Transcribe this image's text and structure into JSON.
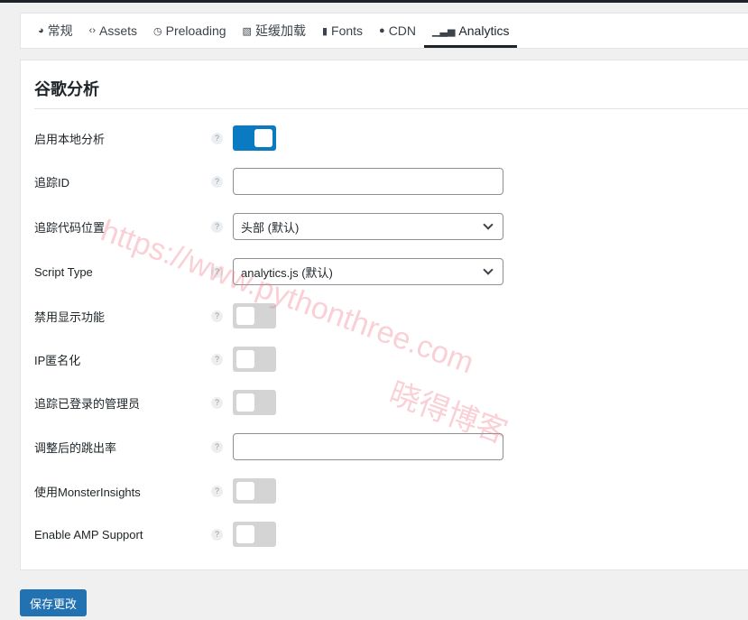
{
  "tabs": [
    {
      "label": "常规",
      "icon": "dashboard-icon"
    },
    {
      "label": "Assets",
      "icon": "code-icon"
    },
    {
      "label": "Preloading",
      "icon": "clock-icon"
    },
    {
      "label": "延缓加载",
      "icon": "image-icon"
    },
    {
      "label": "Fonts",
      "icon": "font-icon"
    },
    {
      "label": "CDN",
      "icon": "globe-icon"
    },
    {
      "label": "Analytics",
      "icon": "bar-chart-icon",
      "active": true
    }
  ],
  "section_title": "谷歌分析",
  "fields": {
    "enable": {
      "label": "启用本地分析",
      "on": true
    },
    "tracking_id": {
      "label": "追踪ID",
      "value": ""
    },
    "code_position": {
      "label": "追踪代码位置",
      "value": "头部 (默认)"
    },
    "script_type": {
      "label": "Script Type",
      "value": "analytics.js (默认)"
    },
    "disable_display": {
      "label": "禁用显示功能",
      "on": false
    },
    "ip_anon": {
      "label": "IP匿名化",
      "on": false
    },
    "track_admins": {
      "label": "追踪已登录的管理员",
      "on": false
    },
    "bounce_rate": {
      "label": "调整后的跳出率",
      "value": ""
    },
    "monsterinsights": {
      "label": "使用MonsterInsights",
      "on": false
    },
    "amp": {
      "label": "Enable AMP Support",
      "on": false
    }
  },
  "help_glyph": "?",
  "save_label": "保存更改",
  "watermark": {
    "url": "https://www.pythonthree.com",
    "name": "晓得博客"
  }
}
